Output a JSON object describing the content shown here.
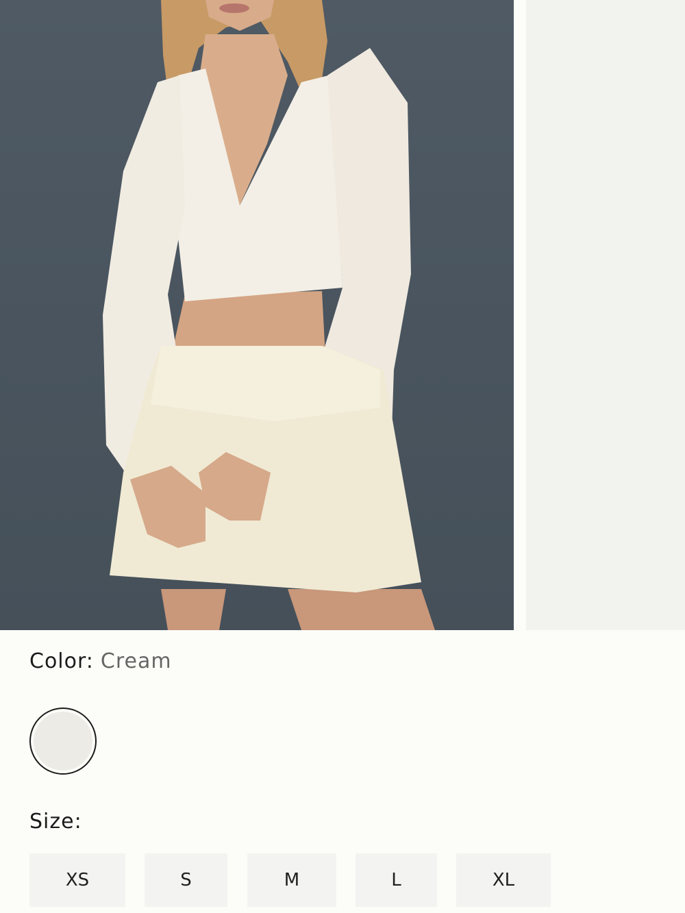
{
  "product": {
    "color_label": "Color:",
    "color_value": "Cream",
    "swatch_color": "#ecebe6",
    "size_label": "Size:",
    "sizes": [
      "XS",
      "S",
      "M",
      "L",
      "XL"
    ]
  }
}
